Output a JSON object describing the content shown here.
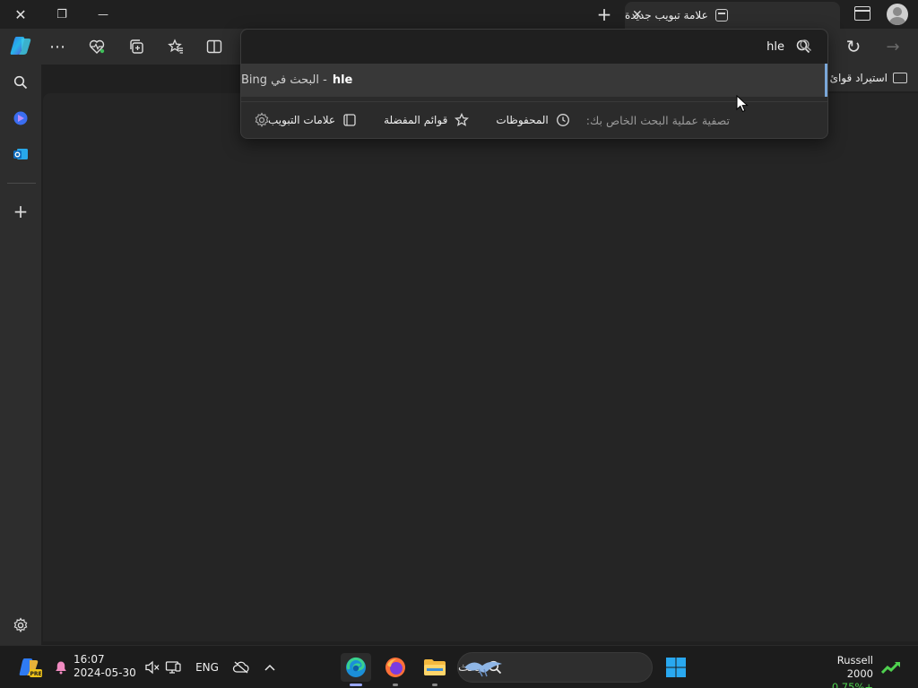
{
  "window": {
    "close_glyph": "✕",
    "restore_glyph": "❐",
    "minimize_glyph": "—"
  },
  "tab": {
    "title": "علامة تبويب جديدة",
    "close_glyph": "✕",
    "new_tab_glyph": "+"
  },
  "toolbar": {
    "more_glyph": "⋯",
    "back_glyph": "→",
    "refresh_glyph": "↻"
  },
  "bookmarks_bar": {
    "import_label": "استيراد قوائ"
  },
  "sidebar": {
    "add_glyph": "+"
  },
  "address_bar": {
    "value": "hle",
    "suggestion_query": "hle",
    "suggestion_text": "- البحث في Bing",
    "filter_hint": "تصفية عملية البحث الخاص بك:",
    "filters": [
      {
        "label": "المحفوظات"
      },
      {
        "label": "قوائم المفضلة"
      },
      {
        "label": "علامات التبويب"
      }
    ]
  },
  "taskbar": {
    "time": "16:07",
    "date": "2024-05-30",
    "language": "ENG",
    "search_placeholder": "بحث",
    "widget_name": "Russell 2000",
    "widget_change": "0.75%+",
    "copilot_badge": "PRE"
  },
  "colors": {
    "accent": "#7aa7d9",
    "positive": "#4fd14f"
  }
}
